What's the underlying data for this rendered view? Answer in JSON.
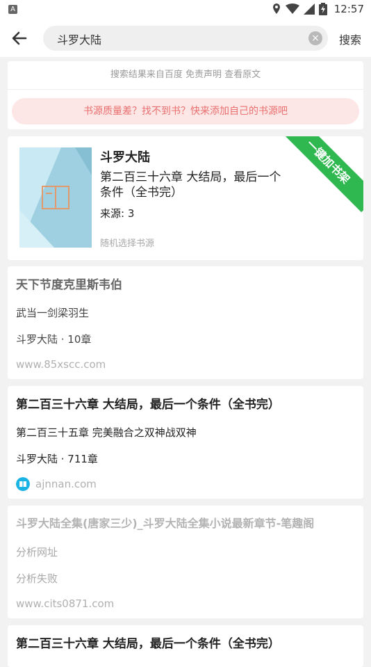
{
  "status_bar": {
    "time": "12:57",
    "app_badge": "A"
  },
  "search": {
    "query": "斗罗大陆",
    "search_label": "搜索"
  },
  "notice": {
    "disclaimer": "搜索结果来自百度  免责声明  查看原文",
    "source_tip": "书源质量差？找不到书？快来添加自己的书源吧"
  },
  "book": {
    "title": "斗罗大陆",
    "latest_chapter": "第二百三十六章 大结局，最后一个条件（全书完）",
    "source_count": "来源: 3",
    "random_source": "随机选择书源",
    "ribbon": "一键加书架"
  },
  "results": [
    {
      "title": "天下节度克里斯韦伯",
      "line2": "武当一剑梁羽生",
      "line3": "斗罗大陆 · 10章",
      "site": "www.85xscc.com",
      "has_logo": false,
      "muted": true
    },
    {
      "title": "第二百三十六章 大结局，最后一个条件（全书完）",
      "line2": "第二百三十五章 完美融合之双神战双神",
      "line3": "斗罗大陆 · 711章",
      "site": "ajnnan.com",
      "has_logo": true,
      "muted": false
    },
    {
      "title": "斗罗大陆全集(唐家三少)_斗罗大陆全集小说最新章节-笔趣阁",
      "line2": "分析网址",
      "line3": "分析失败",
      "site": "www.cits0871.com",
      "has_logo": false,
      "muted": true
    },
    {
      "title": "第二百三十六章 大结局，最后一个条件（全书完）"
    }
  ],
  "colors": {
    "accent_green": "#2fb84f",
    "notice_bg": "#fde6e6",
    "notice_text": "#e9706f",
    "muted_text": "#a8a8a8"
  }
}
